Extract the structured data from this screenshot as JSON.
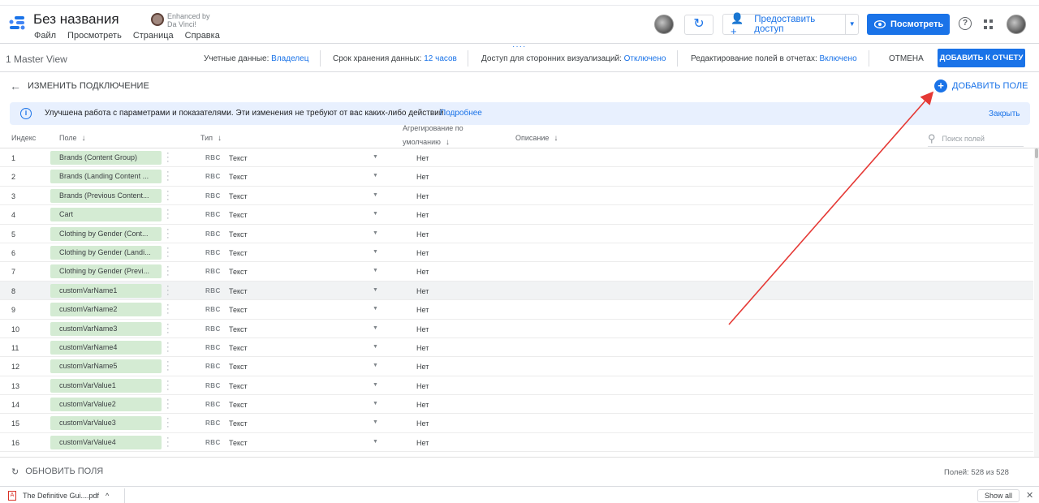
{
  "header": {
    "title": "Без названия",
    "menu": [
      "Файл",
      "Просмотреть",
      "Страница",
      "Справка"
    ],
    "enhanced_line1": "Enhanced by",
    "enhanced_line2": "Da Vinci!",
    "share_label": "Предоставить доступ",
    "view_label": "Посмотреть",
    "help_glyph": "?"
  },
  "infobar": {
    "view_name": "1 Master View",
    "credentials_label": "Учетные данные:",
    "credentials_value": "Владелец",
    "retention_label": "Срок хранения данных:",
    "retention_value": "12 часов",
    "access_label": "Доступ для сторонних визуализаций:",
    "access_value": "Отключено",
    "editing_label": "Редактирование полей в отчетах:",
    "editing_value": "Включено",
    "cancel_label": "ОТМЕНА",
    "add_to_report_label": "ДОБАВИТЬ К ОТЧЕТУ"
  },
  "subbar": {
    "back_label": "ИЗМЕНИТЬ ПОДКЛЮЧЕНИЕ",
    "add_field_label": "ДОБАВИТЬ ПОЛЕ"
  },
  "notice": {
    "text": "Улучшена работа с параметрами и показателями. Эти изменения не требуют от вас каких-либо действий.",
    "link": "Подробнее",
    "close": "Закрыть"
  },
  "table": {
    "headers": {
      "index": "Индекс",
      "field": "Поле",
      "type": "Тип",
      "agg_line1": "Агрегирование по",
      "agg_line2": "умолчанию",
      "description": "Описание"
    },
    "search_placeholder": "Поиск полей",
    "rows": [
      {
        "index": "1",
        "field": "Brands (Content Group)",
        "type": "Текст",
        "agg": "Нет"
      },
      {
        "index": "2",
        "field": "Brands (Landing Content ...",
        "type": "Текст",
        "agg": "Нет"
      },
      {
        "index": "3",
        "field": "Brands (Previous Content...",
        "type": "Текст",
        "agg": "Нет"
      },
      {
        "index": "4",
        "field": "Cart",
        "type": "Текст",
        "agg": "Нет"
      },
      {
        "index": "5",
        "field": "Clothing by Gender (Cont...",
        "type": "Текст",
        "agg": "Нет"
      },
      {
        "index": "6",
        "field": "Clothing by Gender (Landi...",
        "type": "Текст",
        "agg": "Нет"
      },
      {
        "index": "7",
        "field": "Clothing by Gender (Previ...",
        "type": "Текст",
        "agg": "Нет"
      },
      {
        "index": "8",
        "field": "customVarName1",
        "type": "Текст",
        "agg": "Нет"
      },
      {
        "index": "9",
        "field": "customVarName2",
        "type": "Текст",
        "agg": "Нет"
      },
      {
        "index": "10",
        "field": "customVarName3",
        "type": "Текст",
        "agg": "Нет"
      },
      {
        "index": "11",
        "field": "customVarName4",
        "type": "Текст",
        "agg": "Нет"
      },
      {
        "index": "12",
        "field": "customVarName5",
        "type": "Текст",
        "agg": "Нет"
      },
      {
        "index": "13",
        "field": "customVarValue1",
        "type": "Текст",
        "agg": "Нет"
      },
      {
        "index": "14",
        "field": "customVarValue2",
        "type": "Текст",
        "agg": "Нет"
      },
      {
        "index": "15",
        "field": "customVarValue3",
        "type": "Текст",
        "agg": "Нет"
      },
      {
        "index": "16",
        "field": "customVarValue4",
        "type": "Текст",
        "agg": "Нет"
      }
    ],
    "type_abbr": "RBC"
  },
  "footer": {
    "refresh_label": "ОБНОВИТЬ ПОЛЯ",
    "count": "Полей: 528 из 528"
  },
  "downloads": {
    "file": "The Definitive Gui....pdf",
    "show_all": "Show all"
  },
  "colors": {
    "accent": "#1a73e8",
    "chip": "#d4ebd3",
    "annotation_arrow": "#e53935"
  }
}
